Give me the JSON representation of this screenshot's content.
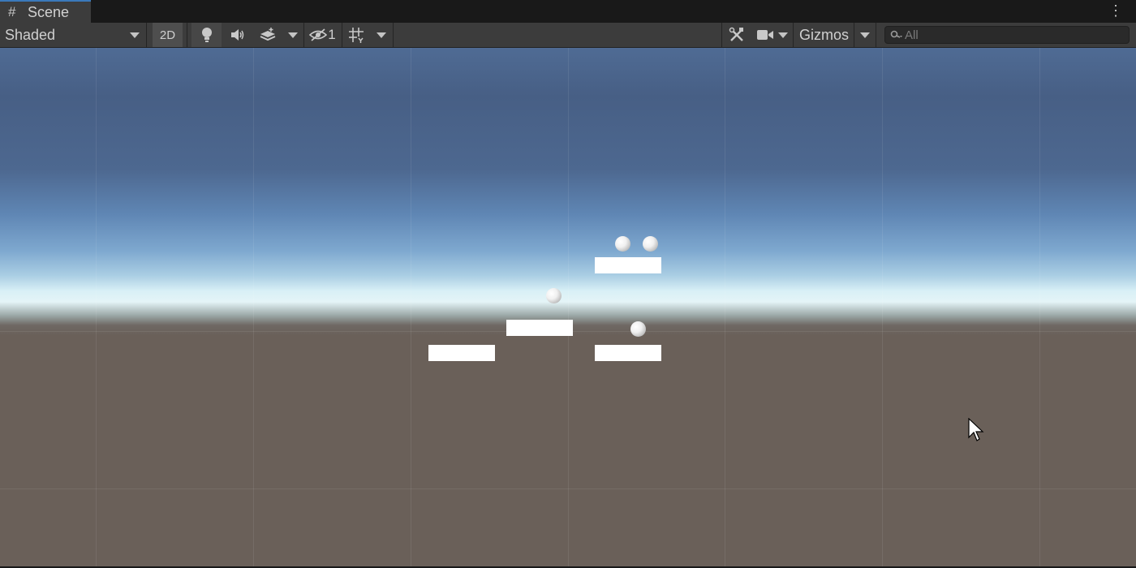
{
  "tab": {
    "icon": "grid-hash-icon",
    "icon_glyph": "#",
    "label": "Scene",
    "menu_glyph": "⋮"
  },
  "toolbar": {
    "shading_mode": "Shaded",
    "mode_2d": "2D",
    "hidden_count": "1",
    "gizmos_label": "Gizmos",
    "search_placeholder": "All"
  },
  "colors": {
    "toolbar_bg": "#3c3c3c",
    "tab_active_accent": "#3a79bb",
    "sky_top": "#4f6b94",
    "horizon": "#e4f4f7",
    "ground": "#6a6059",
    "objects": "#ffffff"
  },
  "scene": {
    "object_types": [
      "platform",
      "sphere"
    ],
    "platform_count": 4,
    "sphere_count": 4
  }
}
